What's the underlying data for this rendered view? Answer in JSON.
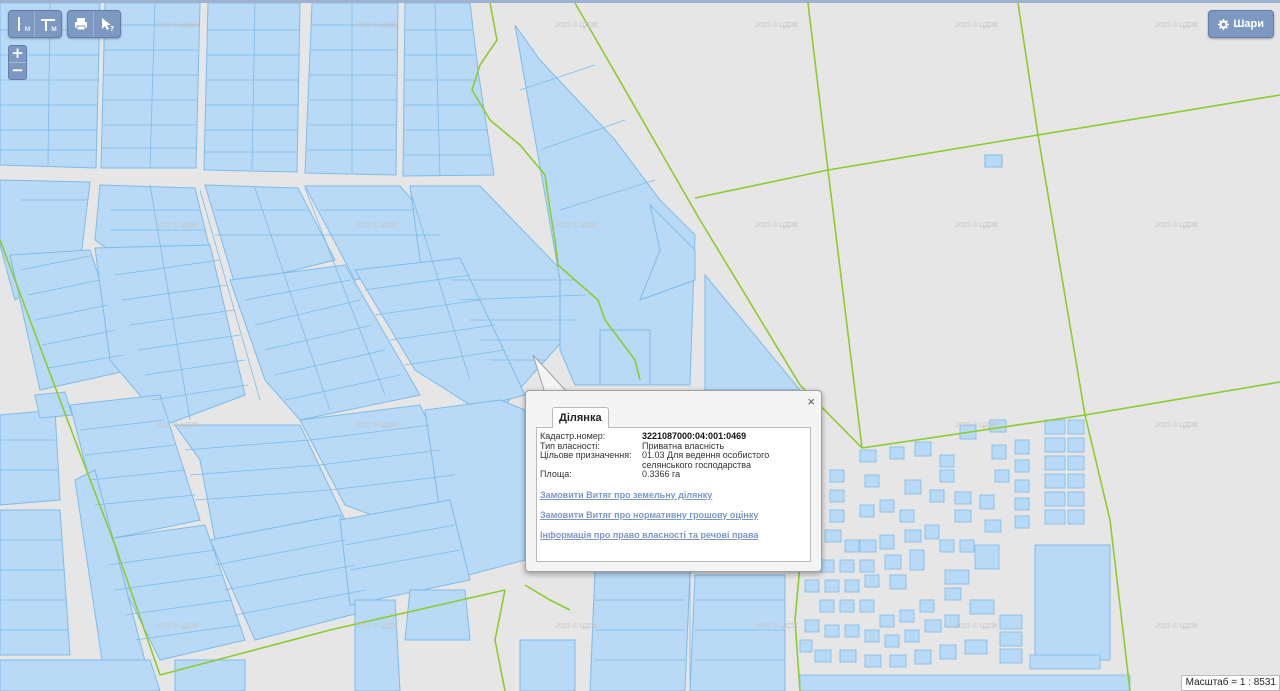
{
  "toolbar": {
    "measure_length_label": "м",
    "measure_area_label": "м",
    "print_icon": "printer-icon",
    "identify_icon": "pointer-question-icon"
  },
  "zoom": {
    "in_label": "+",
    "out_label": "−"
  },
  "layers_button": {
    "label": "Шари",
    "icon": "gear-icon"
  },
  "watermark": "2015 © ЦДЗК",
  "popup": {
    "tab": "Ділянка",
    "fields": [
      {
        "label": "Кадастр.номер:",
        "value": "3221087000:04:001:0469",
        "bold": true
      },
      {
        "label": "Тип власності:",
        "value": "Приватна власність"
      },
      {
        "label": "Цільове призначення:",
        "value": "01.03 Для ведення особистого селянського господарства"
      },
      {
        "label": "Площа:",
        "value": "0.3366 га"
      }
    ],
    "links": [
      "Замовити Витяг про земельну ділянку",
      "Замовити Витяг про нормативну грошову оцінку",
      "Інформація про право власності та речові права"
    ],
    "close_label": "×"
  },
  "scale": {
    "label": "Масштаб = 1 : 8531"
  },
  "colors": {
    "parcel_fill": "#b9daf7",
    "parcel_stroke": "#7fbbe8",
    "boundary": "#8ccc2e",
    "background": "#e6e6e6",
    "tool_bg": "#7e99c1"
  }
}
